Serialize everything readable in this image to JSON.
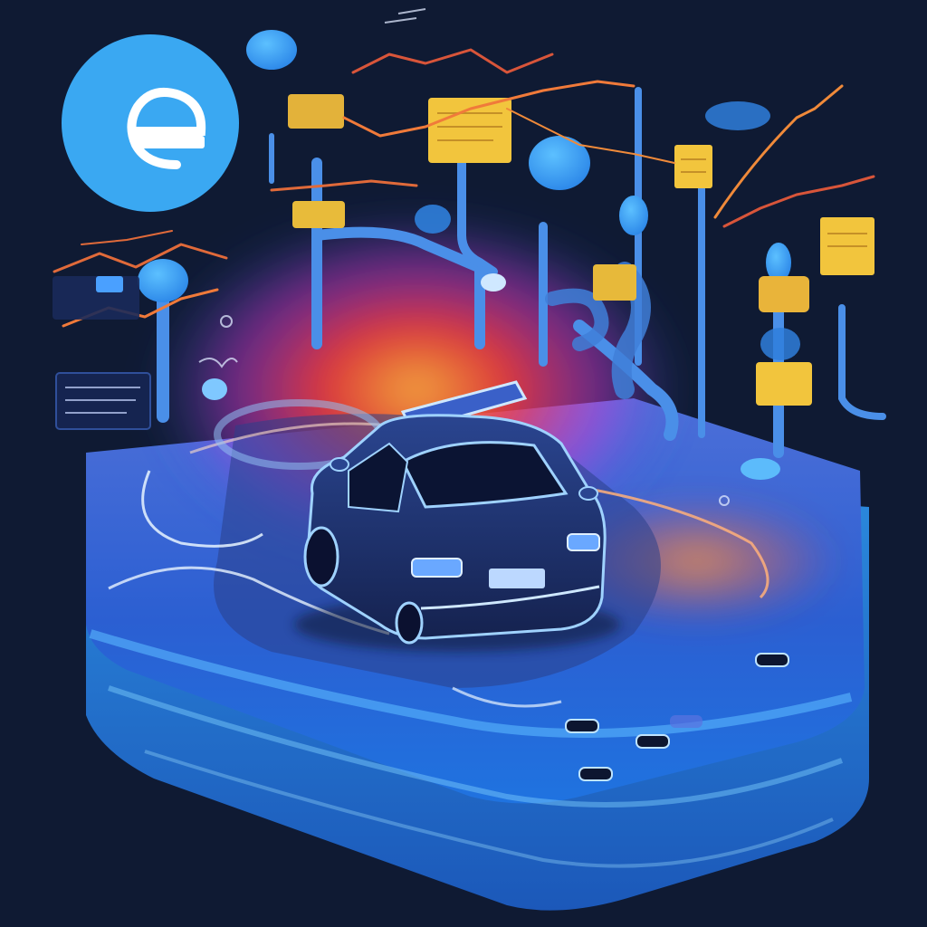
{
  "palette": {
    "background": "#0f1a33",
    "platform_top": "#1f5fd6",
    "platform_edge": "#2f8ff0",
    "road": "#2a3f8a",
    "glow_red": "#ff3b3b",
    "glow_orange": "#ff9a3c",
    "glow_magenta": "#c93ae0",
    "sign_yellow": "#f2c53d",
    "pipe_blue": "#4a8fe8",
    "bubble_blue": "#3aa8f2",
    "car_body": "#1d2f6b",
    "car_outline": "#9fd2ff",
    "chart_line_orange": "#f07a3a",
    "chart_line_red": "#d8553a"
  },
  "icons": {
    "logo": "emblem-icon",
    "vehicle": "car-icon"
  }
}
